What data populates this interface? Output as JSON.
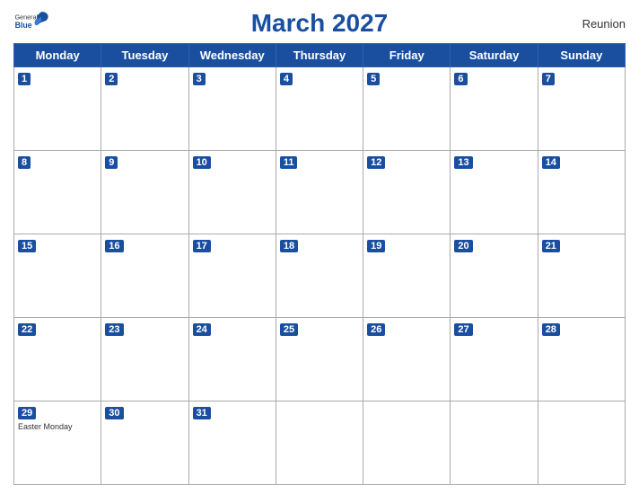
{
  "header": {
    "title": "March 2027",
    "region": "Reunion",
    "logo": {
      "general": "General",
      "blue": "Blue"
    }
  },
  "days_of_week": [
    "Monday",
    "Tuesday",
    "Wednesday",
    "Thursday",
    "Friday",
    "Saturday",
    "Sunday"
  ],
  "weeks": [
    [
      {
        "day": 1,
        "holiday": null
      },
      {
        "day": 2,
        "holiday": null
      },
      {
        "day": 3,
        "holiday": null
      },
      {
        "day": 4,
        "holiday": null
      },
      {
        "day": 5,
        "holiday": null
      },
      {
        "day": 6,
        "holiday": null
      },
      {
        "day": 7,
        "holiday": null
      }
    ],
    [
      {
        "day": 8,
        "holiday": null
      },
      {
        "day": 9,
        "holiday": null
      },
      {
        "day": 10,
        "holiday": null
      },
      {
        "day": 11,
        "holiday": null
      },
      {
        "day": 12,
        "holiday": null
      },
      {
        "day": 13,
        "holiday": null
      },
      {
        "day": 14,
        "holiday": null
      }
    ],
    [
      {
        "day": 15,
        "holiday": null
      },
      {
        "day": 16,
        "holiday": null
      },
      {
        "day": 17,
        "holiday": null
      },
      {
        "day": 18,
        "holiday": null
      },
      {
        "day": 19,
        "holiday": null
      },
      {
        "day": 20,
        "holiday": null
      },
      {
        "day": 21,
        "holiday": null
      }
    ],
    [
      {
        "day": 22,
        "holiday": null
      },
      {
        "day": 23,
        "holiday": null
      },
      {
        "day": 24,
        "holiday": null
      },
      {
        "day": 25,
        "holiday": null
      },
      {
        "day": 26,
        "holiday": null
      },
      {
        "day": 27,
        "holiday": null
      },
      {
        "day": 28,
        "holiday": null
      }
    ],
    [
      {
        "day": 29,
        "holiday": "Easter Monday"
      },
      {
        "day": 30,
        "holiday": null
      },
      {
        "day": 31,
        "holiday": null
      },
      {
        "day": null,
        "holiday": null
      },
      {
        "day": null,
        "holiday": null
      },
      {
        "day": null,
        "holiday": null
      },
      {
        "day": null,
        "holiday": null
      }
    ]
  ]
}
